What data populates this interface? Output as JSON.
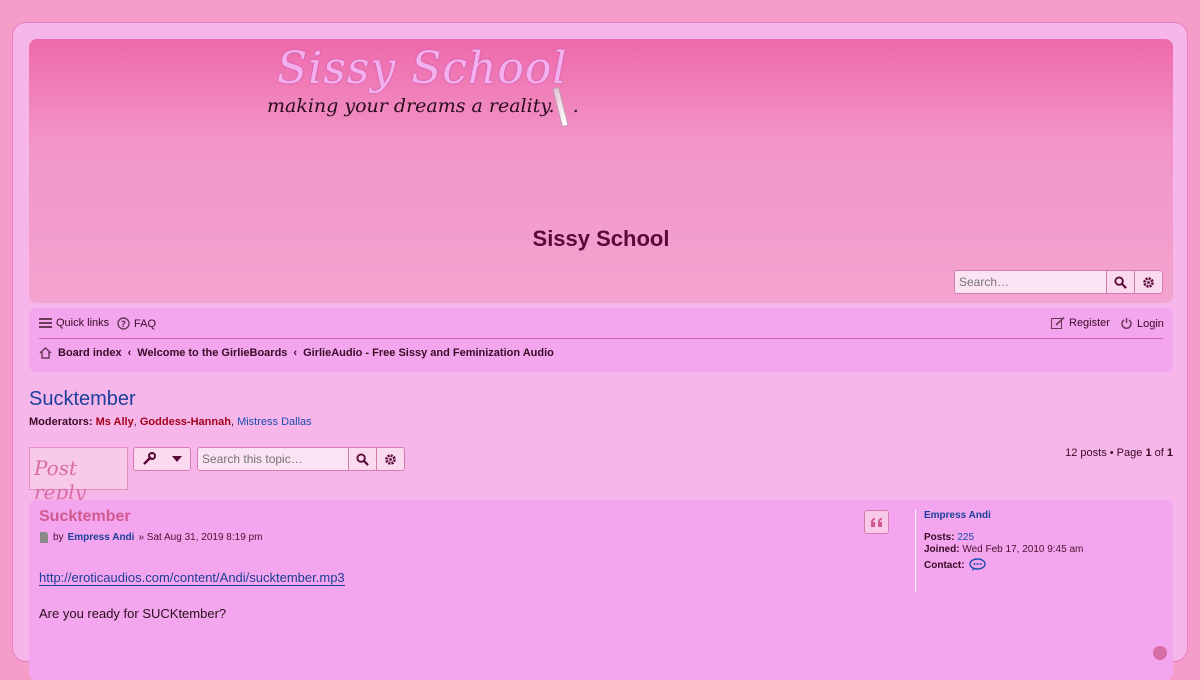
{
  "header": {
    "logo_script": "Sissy School",
    "logo_tagline": "making your dreams a reality. . .",
    "site_title": "Sissy School",
    "search_placeholder": "Search…"
  },
  "nav": {
    "quick_links": "Quick links",
    "faq": "FAQ",
    "register": "Register",
    "login": "Login",
    "breadcrumbs": [
      "Board index",
      "Welcome to the GirlieBoards",
      "GirlieAudio - Free Sissy and Feminization Audio"
    ]
  },
  "topic": {
    "title": "Sucktember",
    "moderators_label": "Moderators:",
    "moderators": [
      "Ms Ally",
      "Goddess-Hannah",
      "Mistress Dallas"
    ],
    "post_reply": "Post reply",
    "search_placeholder": "Search this topic…",
    "pagination_prefix": "12 posts • Page",
    "page_current": "1",
    "page_of": "of",
    "page_total": "1"
  },
  "post": {
    "title": "Sucktember",
    "by": "by",
    "author": "Empress Andi",
    "date": "» Sat Aug 31, 2019 8:19 pm",
    "link": "http://eroticaudios.com/content/Andi/sucktember.mp3",
    "text": "Are you ready for SUCKtember?",
    "profile": {
      "username": "Empress Andi",
      "posts_label": "Posts:",
      "posts": "225",
      "joined_label": "Joined:",
      "joined": "Wed Feb 17, 2010 9:45 am",
      "contact_label": "Contact:"
    }
  },
  "colors": {
    "page_bg": "#f69cc8",
    "panel": "#f3a6ee",
    "link": "#1b3f9a",
    "moderator_red": "#a5001c",
    "title_pink": "#d05a90"
  }
}
